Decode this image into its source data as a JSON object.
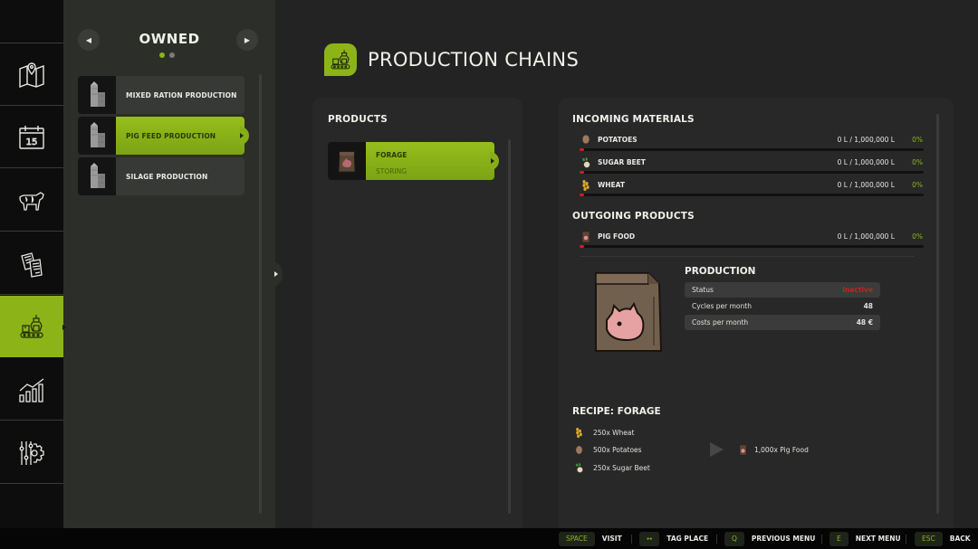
{
  "rail": {
    "items": [
      {
        "id": "map",
        "icon": "map-icon"
      },
      {
        "id": "calendar",
        "icon": "calendar-icon",
        "day": "15"
      },
      {
        "id": "animals",
        "icon": "cow-icon"
      },
      {
        "id": "contracts",
        "icon": "documents-icon"
      },
      {
        "id": "production",
        "icon": "production-icon",
        "active": true
      },
      {
        "id": "statistics",
        "icon": "statistics-icon"
      },
      {
        "id": "settings",
        "icon": "settings-icon"
      }
    ]
  },
  "list": {
    "title": "OWNED",
    "page_count": 2,
    "current_page": 1,
    "items": [
      {
        "label": "MIXED RATION PRODUCTION",
        "icon": "silo-icon"
      },
      {
        "label": "PIG FEED PRODUCTION",
        "icon": "silo-icon",
        "selected": true
      },
      {
        "label": "SILAGE PRODUCTION",
        "icon": "silo-icon"
      }
    ]
  },
  "header": {
    "title": "PRODUCTION CHAINS",
    "icon": "production-icon"
  },
  "products": {
    "heading": "PRODUCTS",
    "items": [
      {
        "name": "FORAGE",
        "state": "STORING",
        "icon": "pig-food-icon",
        "selected": true
      }
    ]
  },
  "incoming": {
    "heading": "INCOMING MATERIALS",
    "items": [
      {
        "name": "POTATOES",
        "icon": "potato-icon",
        "amount": "0 L / 1,000,000 L",
        "percent": "0%",
        "fill": 0
      },
      {
        "name": "SUGAR BEET",
        "icon": "sugar-beet-icon",
        "amount": "0 L / 1,000,000 L",
        "percent": "0%",
        "fill": 0
      },
      {
        "name": "WHEAT",
        "icon": "wheat-icon",
        "amount": "0 L / 1,000,000 L",
        "percent": "0%",
        "fill": 0
      }
    ]
  },
  "outgoing": {
    "heading": "OUTGOING PRODUCTS",
    "items": [
      {
        "name": "PIG FOOD",
        "icon": "pig-food-icon",
        "amount": "0 L / 1,000,000 L",
        "percent": "0%",
        "fill": 0
      }
    ]
  },
  "production": {
    "heading": "PRODUCTION",
    "rows": [
      {
        "label": "Status",
        "value": "Inactive",
        "status": "inactive"
      },
      {
        "label": "Cycles per month",
        "value": "48"
      },
      {
        "label": "Costs per month",
        "value": "48 €"
      }
    ]
  },
  "recipe": {
    "heading": "RECIPE: FORAGE",
    "inputs": [
      {
        "label": "250x Wheat",
        "icon": "wheat-icon"
      },
      {
        "label": "500x Potatoes",
        "icon": "potato-icon"
      },
      {
        "label": "250x Sugar Beet",
        "icon": "sugar-beet-icon"
      }
    ],
    "output": {
      "label": "1,000x Pig Food",
      "icon": "pig-food-icon"
    }
  },
  "hints": [
    {
      "key": "SPACE",
      "label": "VISIT"
    },
    {
      "key": "↔",
      "label": "TAG PLACE"
    },
    {
      "key": "Q",
      "label": "PREVIOUS MENU"
    },
    {
      "key": "E",
      "label": "NEXT MENU"
    },
    {
      "key": "ESC",
      "label": "BACK"
    }
  ],
  "colors": {
    "accent": "#8cb418",
    "inactive": "#d21c1c",
    "bar_empty": "#d41e1e"
  }
}
